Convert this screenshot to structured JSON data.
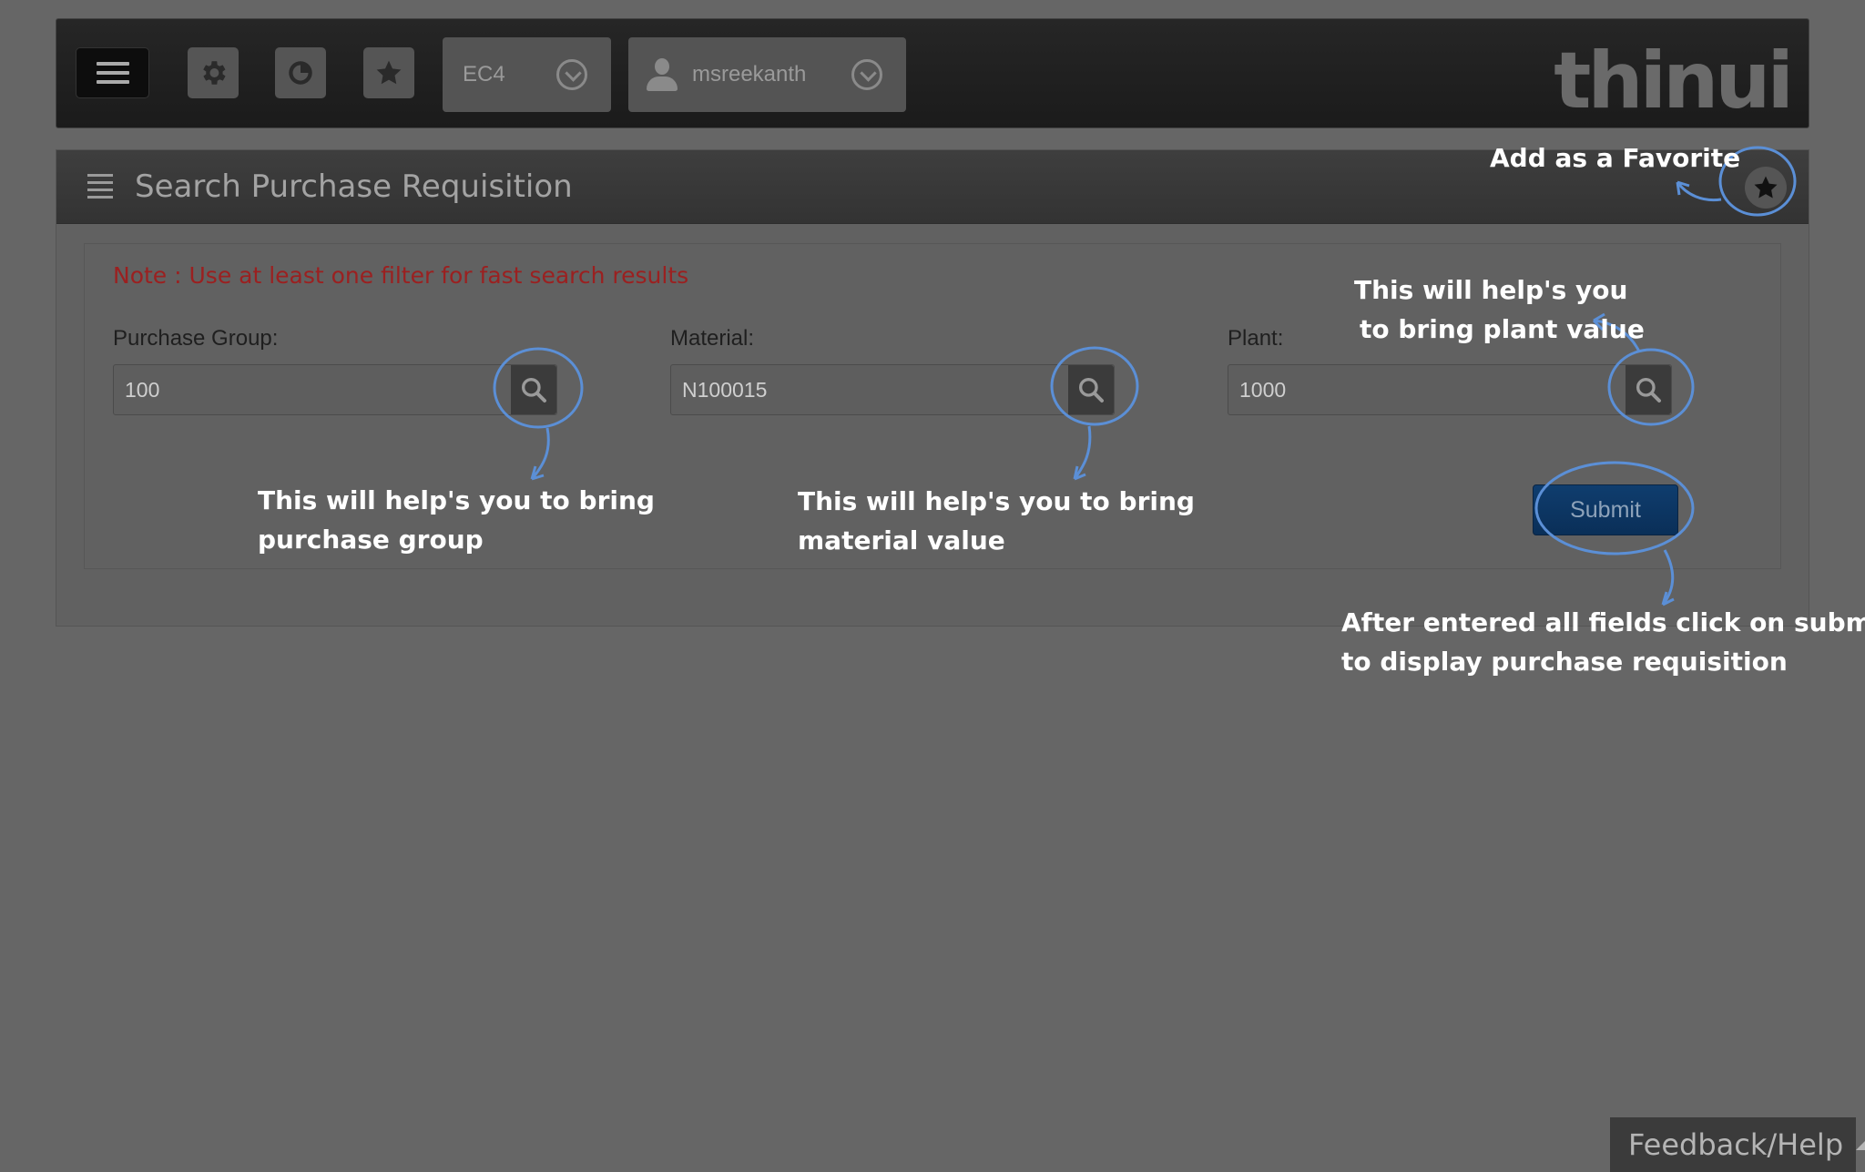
{
  "topbar": {
    "system": "EC4",
    "user": "msreekanth",
    "logo": "thinui"
  },
  "page": {
    "title": "Search Purchase Requisition",
    "note": "Note : Use at least one filter for fast search results"
  },
  "fields": {
    "purchase_group": {
      "label": "Purchase Group:",
      "value": "100"
    },
    "material": {
      "label": "Material:",
      "value": "N100015"
    },
    "plant": {
      "label": "Plant:",
      "value": "1000"
    }
  },
  "actions": {
    "submit_label": "Submit"
  },
  "annotations": {
    "favorite": "Add as a Favorite",
    "plant_l1": "This will help's you",
    "plant_l2": "to bring plant value",
    "group_l1": "This will help's you to bring",
    "group_l2": "purchase group",
    "material_l1": "This will help's you to bring",
    "material_l2": "material value",
    "submit_l1": "After entered all fields click on submit",
    "submit_l2": "to display purchase requisition"
  },
  "footer": {
    "feedback": "Feedback/Help"
  },
  "icons": [
    "menu-icon",
    "gear-icon",
    "chart-icon",
    "star-icon",
    "chevron-down-icon",
    "user-icon",
    "list-icon",
    "search-icon"
  ],
  "colors": {
    "annotation_circle": "#5b8fd6",
    "note_text": "#9b2020",
    "submit_bg": "#0f3d6e"
  }
}
